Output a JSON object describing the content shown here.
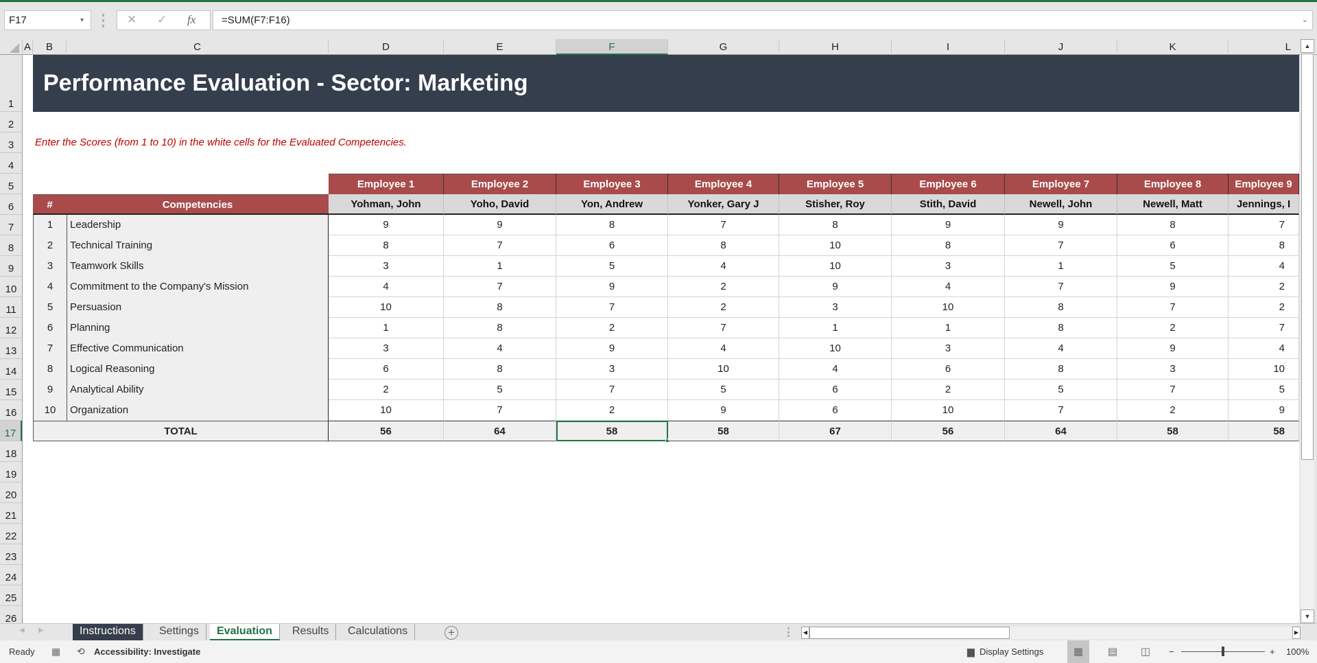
{
  "formula_bar": {
    "name_box": "F17",
    "cancel_icon": "✕",
    "enter_icon": "✓",
    "fx_label": "fx",
    "formula": "=SUM(F7:F16)"
  },
  "column_headers": [
    "A",
    "B",
    "C",
    "D",
    "E",
    "F",
    "G",
    "H",
    "I",
    "J",
    "K",
    "L"
  ],
  "selected_column": "F",
  "row_headers": [
    "1",
    "2",
    "3",
    "4",
    "5",
    "6",
    "7",
    "8",
    "9",
    "10",
    "11",
    "12",
    "13",
    "14",
    "15",
    "16",
    "17",
    "18",
    "19",
    "20",
    "21",
    "22",
    "23",
    "24",
    "25",
    "26"
  ],
  "selected_row": "17",
  "sheet": {
    "title": "Performance Evaluation - Sector: Marketing",
    "instruction": "Enter the Scores (from 1 to 10) in the white cells for the Evaluated Competencies.",
    "num_header": "#",
    "competencies_header": "Competencies",
    "total_label": "TOTAL",
    "employees": [
      {
        "label": "Employee 1",
        "name": "Yohman, John"
      },
      {
        "label": "Employee 2",
        "name": "Yoho, David"
      },
      {
        "label": "Employee 3",
        "name": "Yon, Andrew"
      },
      {
        "label": "Employee 4",
        "name": "Yonker, Gary J"
      },
      {
        "label": "Employee 5",
        "name": "Stisher, Roy"
      },
      {
        "label": "Employee 6",
        "name": "Stith, David"
      },
      {
        "label": "Employee 7",
        "name": "Newell, John"
      },
      {
        "label": "Employee 8",
        "name": "Newell, Matt"
      },
      {
        "label": "Employee 9",
        "name": "Jennings, I"
      }
    ],
    "competencies": [
      {
        "num": "1",
        "name": "Leadership",
        "scores": [
          "9",
          "9",
          "8",
          "7",
          "8",
          "9",
          "9",
          "8",
          "7"
        ]
      },
      {
        "num": "2",
        "name": "Technical Training",
        "scores": [
          "8",
          "7",
          "6",
          "8",
          "10",
          "8",
          "7",
          "6",
          "8"
        ]
      },
      {
        "num": "3",
        "name": "Teamwork Skills",
        "scores": [
          "3",
          "1",
          "5",
          "4",
          "10",
          "3",
          "1",
          "5",
          "4"
        ]
      },
      {
        "num": "4",
        "name": "Commitment to the Company's Mission",
        "scores": [
          "4",
          "7",
          "9",
          "2",
          "9",
          "4",
          "7",
          "9",
          "2"
        ]
      },
      {
        "num": "5",
        "name": "Persuasion",
        "scores": [
          "10",
          "8",
          "7",
          "2",
          "3",
          "10",
          "8",
          "7",
          "2"
        ]
      },
      {
        "num": "6",
        "name": "Planning",
        "scores": [
          "1",
          "8",
          "2",
          "7",
          "1",
          "1",
          "8",
          "2",
          "7"
        ]
      },
      {
        "num": "7",
        "name": "Effective Communication",
        "scores": [
          "3",
          "4",
          "9",
          "4",
          "10",
          "3",
          "4",
          "9",
          "4"
        ]
      },
      {
        "num": "8",
        "name": "Logical Reasoning",
        "scores": [
          "6",
          "8",
          "3",
          "10",
          "4",
          "6",
          "8",
          "3",
          "10"
        ]
      },
      {
        "num": "9",
        "name": "Analytical Ability",
        "scores": [
          "2",
          "5",
          "7",
          "5",
          "6",
          "2",
          "5",
          "7",
          "5"
        ]
      },
      {
        "num": "10",
        "name": "Organization",
        "scores": [
          "10",
          "7",
          "2",
          "9",
          "6",
          "10",
          "7",
          "2",
          "9"
        ]
      }
    ],
    "totals": [
      "56",
      "64",
      "58",
      "58",
      "67",
      "56",
      "64",
      "58",
      "58"
    ],
    "selected_total_index": 2
  },
  "tabs": [
    {
      "label": "Instructions",
      "state": "dark"
    },
    {
      "label": "Settings",
      "state": "normal"
    },
    {
      "label": "Evaluation",
      "state": "active"
    },
    {
      "label": "Results",
      "state": "normal"
    },
    {
      "label": "Calculations",
      "state": "normal"
    }
  ],
  "add_sheet_icon": "+",
  "status_bar": {
    "ready": "Ready",
    "accessibility": "Accessibility: Investigate",
    "display_settings": "Display Settings",
    "zoom_minus": "−",
    "zoom_plus": "+",
    "zoom_level": "100%",
    "zoom_fraction": 0.5
  },
  "colors": {
    "accent_green": "#217346",
    "title_bg": "#343e4d",
    "header_red": "#a94b4b",
    "instruction_red": "#c00000"
  }
}
